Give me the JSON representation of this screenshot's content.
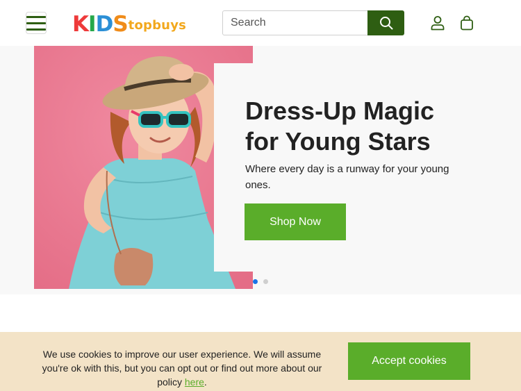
{
  "header": {
    "logo": {
      "letters": [
        "K",
        "I",
        "D",
        "S"
      ],
      "suffix": "topbuys"
    },
    "search": {
      "placeholder": "Search"
    },
    "icons": {
      "menu": "hamburger-icon",
      "search": "search-icon",
      "account": "user-icon",
      "cart": "bag-icon"
    }
  },
  "hero": {
    "title": "Dress-Up Magic for Young Stars",
    "subtitle": "Where every day is a runway for your young ones.",
    "cta_label": "Shop Now",
    "slides_total": 2,
    "slide_active": 1
  },
  "cookie": {
    "text_before": "We use cookies to improve our user experience. We will assume you're ok with this, but you can opt out or find out more about our policy ",
    "link_text": "here",
    "text_after": ".",
    "accept_label": "Accept cookies"
  },
  "colors": {
    "brand_green_dark": "#2e5e12",
    "brand_green": "#5aad2a",
    "hero_pink": "#ec7f95",
    "cookie_bg": "#f3e3c7",
    "dot_active": "#1a73e8"
  }
}
